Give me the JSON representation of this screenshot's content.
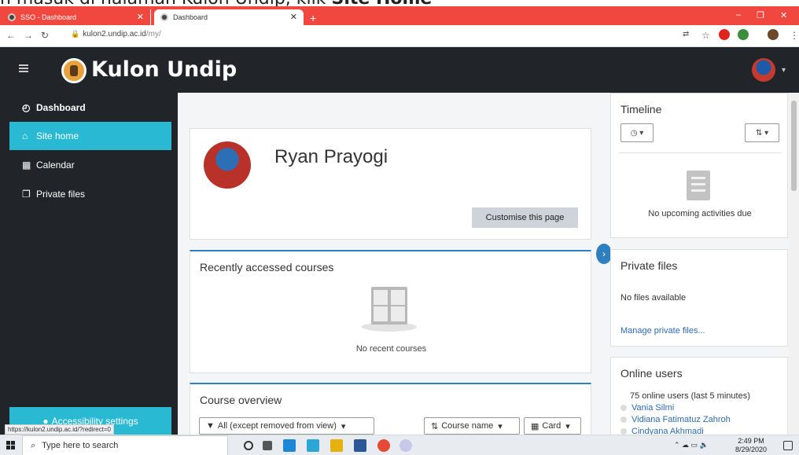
{
  "caption": {
    "prefix": "n masuk di halaman Kulon Undip, klik ",
    "bold": "Site Home"
  },
  "browser": {
    "tabs": [
      {
        "label": "SSO - Dashboard"
      },
      {
        "label": "Dashboard"
      }
    ],
    "url_host": "kulon2.undip.ac.id",
    "url_path": "/my/"
  },
  "site": {
    "brand": "Kulon Undip"
  },
  "sidebar": {
    "items": [
      {
        "label": "Dashboard",
        "icon": "dashboard-icon"
      },
      {
        "label": "Site home",
        "icon": "home-icon"
      },
      {
        "label": "Calendar",
        "icon": "calendar-icon"
      },
      {
        "label": "Private files",
        "icon": "files-icon"
      }
    ],
    "accessibility": "Accessibility settings",
    "status_url": "https://kulon2.undip.ac.id/?redirect=0"
  },
  "profile": {
    "name": "Ryan Prayogi",
    "customise": "Customise this page"
  },
  "recent": {
    "title": "Recently accessed courses",
    "empty": "No recent courses"
  },
  "overview": {
    "title": "Course overview",
    "filter": "All (except removed from view)",
    "sort": "Course name",
    "view": "Card"
  },
  "timeline": {
    "title": "Timeline",
    "empty": "No upcoming activities due"
  },
  "private_files": {
    "title": "Private files",
    "empty": "No files available",
    "manage": "Manage private files..."
  },
  "online": {
    "title": "Online users",
    "summary": "75 online users (last 5 minutes)",
    "users": [
      "Vania Silmi",
      "Vidiana Fatimatuz Zahroh",
      "Cindyana Akhmadi"
    ]
  },
  "taskbar": {
    "search": "Type here to search",
    "time": "2:49 PM",
    "date": "8/29/2020"
  },
  "colors": {
    "accent": "#29b9d3",
    "navbar": "#212529",
    "tabstrip": "#f0483f",
    "link": "#2d6bb3"
  }
}
